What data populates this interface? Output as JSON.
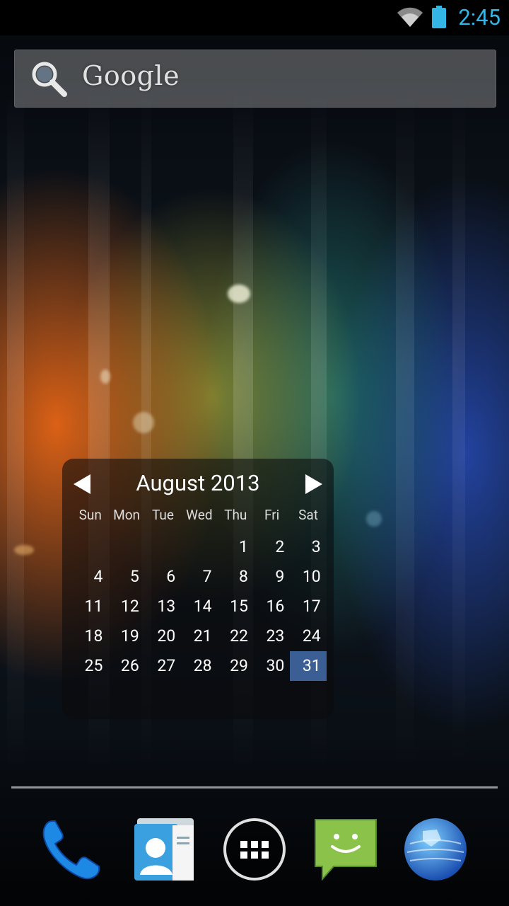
{
  "status": {
    "time": "2:45",
    "wifi_icon": "wifi-icon",
    "battery_icon": "battery-icon",
    "accent": "#33b5e5"
  },
  "search": {
    "label": "Google",
    "icon": "search-icon"
  },
  "calendar": {
    "title": "August 2013",
    "days": [
      "Sun",
      "Mon",
      "Tue",
      "Wed",
      "Thu",
      "Fri",
      "Sat"
    ],
    "weeks": [
      [
        "",
        "",
        "",
        "",
        "1",
        "2",
        "3"
      ],
      [
        "4",
        "5",
        "6",
        "7",
        "8",
        "9",
        "10"
      ],
      [
        "11",
        "12",
        "13",
        "14",
        "15",
        "16",
        "17"
      ],
      [
        "18",
        "19",
        "20",
        "21",
        "22",
        "23",
        "24"
      ],
      [
        "25",
        "26",
        "27",
        "28",
        "29",
        "30",
        "31"
      ]
    ],
    "today": "31",
    "today_color": "#3b5f95"
  },
  "dock": {
    "items": [
      "phone-icon",
      "contacts-icon",
      "apps-icon",
      "messaging-icon",
      "browser-icon"
    ]
  }
}
